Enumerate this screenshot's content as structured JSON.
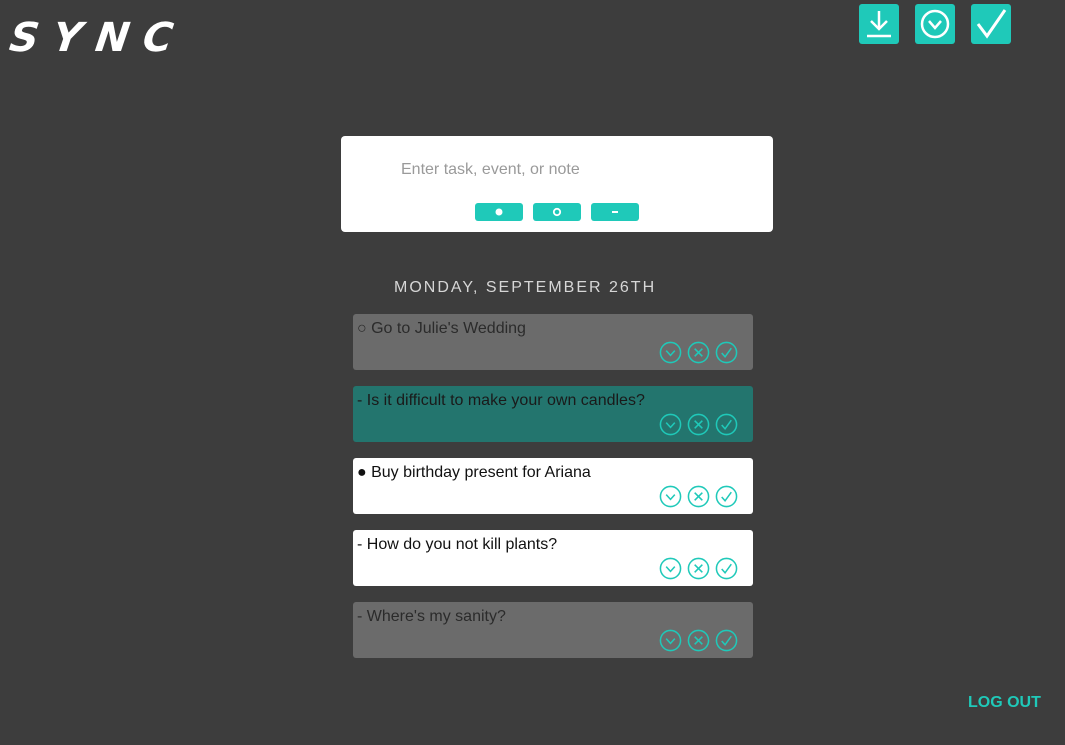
{
  "app": {
    "logo": "SYNC"
  },
  "top_icons": [
    "download-icon",
    "clock-icon",
    "check-icon"
  ],
  "input": {
    "placeholder": "Enter task, event, or note",
    "value": ""
  },
  "type_buttons": [
    {
      "icon": "filled-dot-icon"
    },
    {
      "icon": "hollow-circle-icon"
    },
    {
      "icon": "dash-icon"
    }
  ],
  "date_header": "MONDAY, SEPTEMBER 26TH",
  "entries": [
    {
      "text": "○ Go to Julie's Wedding",
      "style": "gray"
    },
    {
      "text": "- Is it difficult to make your own candles?",
      "style": "teal"
    },
    {
      "text": "● Buy birthday present for Ariana",
      "style": "white"
    },
    {
      "text": "- How do you not kill plants?",
      "style": "white"
    },
    {
      "text": "- Where's my sanity?",
      "style": "gray"
    }
  ],
  "logout_label": "LOG OUT",
  "colors": {
    "background": "#3d3d3d",
    "accent": "#1fc9b9",
    "card_gray": "#6b6b6b",
    "card_teal": "#23756e",
    "card_white": "#ffffff"
  }
}
